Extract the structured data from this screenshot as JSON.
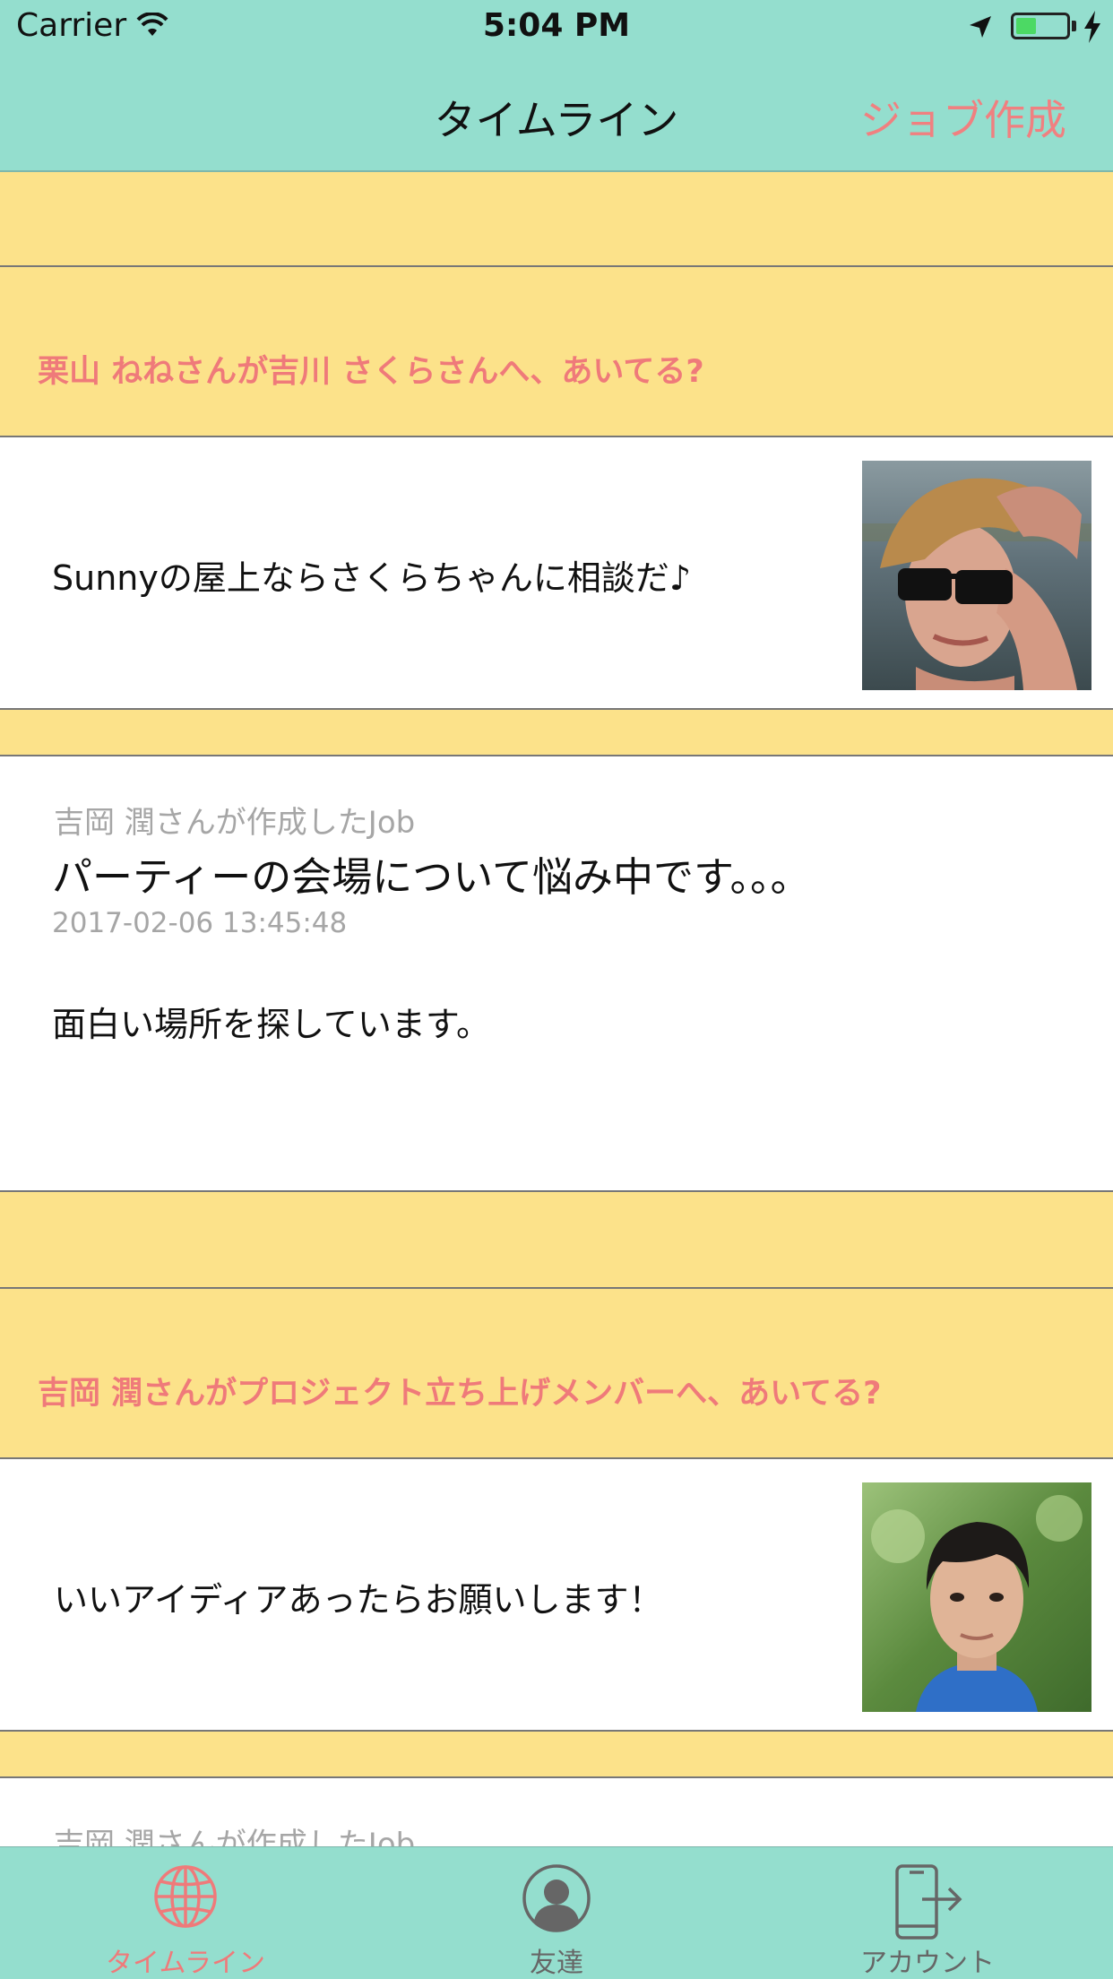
{
  "status": {
    "carrier": "Carrier",
    "time": "5:04 PM"
  },
  "nav": {
    "title": "タイムライン",
    "action": "ジョブ作成"
  },
  "timeline": {
    "mention1": {
      "heading": "栗山 ねねさんが吉川 さくらさんへ、あいてる?",
      "message": "Sunnyの屋上ならさくらちゃんに相談だ♪",
      "photo_icon": "woman-sunglasses-hat-photo"
    },
    "job1": {
      "meta": "吉岡 潤さんが作成したJob",
      "title": "パーティーの会場について悩み中です。。。",
      "date": "2017-02-06 13:45:48",
      "body": "面白い場所を探しています。"
    },
    "mention2": {
      "heading": "吉岡 潤さんがプロジェクト立ち上げメンバーへ、あいてる?",
      "message": "いいアイディアあったらお願いします！",
      "photo_icon": "man-portrait-photo"
    },
    "job2": {
      "meta": "吉岡 潤さんが作成したJob"
    }
  },
  "tabs": [
    {
      "label": "タイムライン",
      "icon": "globe-icon",
      "active": true
    },
    {
      "label": "友達",
      "icon": "person-icon",
      "active": false
    },
    {
      "label": "アカウント",
      "icon": "logout-phone-icon",
      "active": false
    }
  ],
  "colors": {
    "bar": "#94dece",
    "band": "#fce28a",
    "accent": "#ef7a7a",
    "inactive": "#666666"
  }
}
